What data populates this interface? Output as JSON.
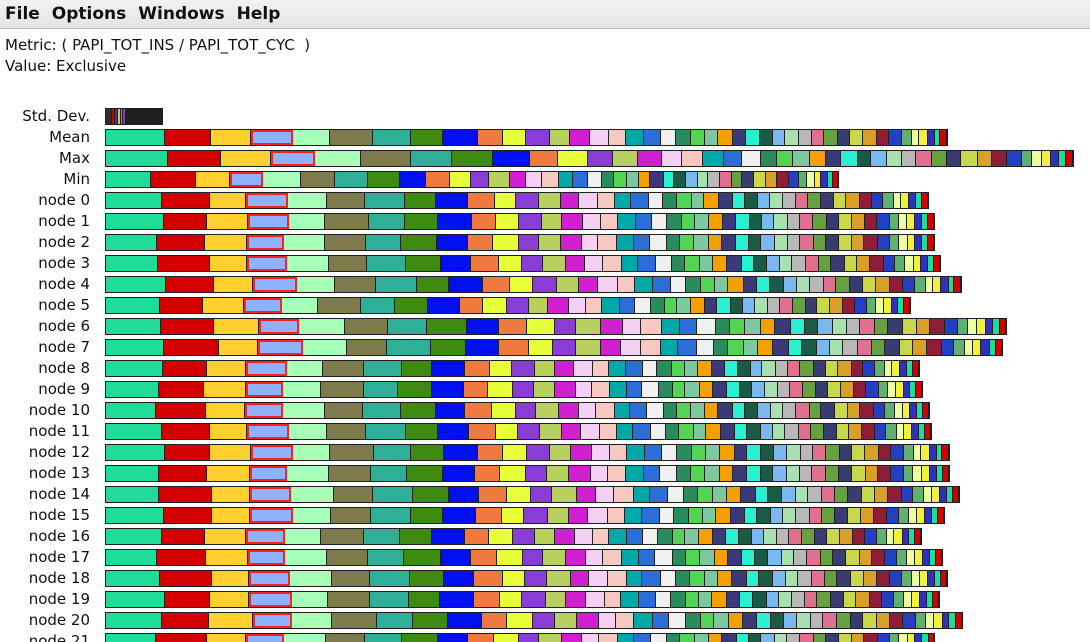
{
  "menu": [
    "File",
    "Options",
    "Windows",
    "Help"
  ],
  "info": {
    "metric": "Metric: ( PAPI_TOT_INS / PAPI_TOT_CYC  )",
    "value": "Value: Exclusive"
  },
  "colors": {
    "palette": [
      "#1fdc99",
      "#d40000",
      "#ffd030",
      "#8fb2ff",
      "#a8ffb8",
      "#7d7a4b",
      "#2fae98",
      "#3f8a10",
      "#0010ee",
      "#ee7a40",
      "#e6ff38",
      "#8a3cd6",
      "#b8d060",
      "#d020d0",
      "#f4d0f4",
      "#f6c8c0",
      "#00a8a8",
      "#2c6ed8",
      "#f0f0f0",
      "#2a8c5c",
      "#54d454",
      "#7ec8a0",
      "#f4a000",
      "#3a3a7a",
      "#28f0d0",
      "#1c5a48",
      "#7ab8f0",
      "#a8e0b0",
      "#b8b8b8",
      "#e07090",
      "#66a040",
      "#383c70",
      "#c8d84a",
      "#d8a028",
      "#8e1e38",
      "#2440c0",
      "#60b070",
      "#eeffa0",
      "#f0f040",
      "#3030c0"
    ],
    "highlight": "#ff2020"
  },
  "rows": [
    {
      "label": "Std. Dev.",
      "total": 58
    },
    {
      "label": "Mean",
      "total": 843
    },
    {
      "label": "Max",
      "total": 969
    },
    {
      "label": "Min",
      "total": 734
    },
    {
      "label": "node 0",
      "total": 824
    },
    {
      "label": "node 1",
      "total": 830
    },
    {
      "label": "node 2",
      "total": 830
    },
    {
      "label": "node 3",
      "total": 836
    },
    {
      "label": "node 4",
      "total": 857
    },
    {
      "label": "node 5",
      "total": 806
    },
    {
      "label": "node 6",
      "total": 902
    },
    {
      "label": "node 7",
      "total": 898
    },
    {
      "label": "node 8",
      "total": 815
    },
    {
      "label": "node 9",
      "total": 818
    },
    {
      "label": "node 10",
      "total": 825
    },
    {
      "label": "node 11",
      "total": 827
    },
    {
      "label": "node 12",
      "total": 845
    },
    {
      "label": "node 13",
      "total": 845
    },
    {
      "label": "node 14",
      "total": 855
    },
    {
      "label": "node 15",
      "total": 840
    },
    {
      "label": "node 16",
      "total": 817
    },
    {
      "label": "node 17",
      "total": 838
    },
    {
      "label": "node 18",
      "total": 843
    },
    {
      "label": "node 19",
      "total": 835
    },
    {
      "label": "node 20",
      "total": 858
    },
    {
      "label": "node 21",
      "total": 830
    }
  ]
}
